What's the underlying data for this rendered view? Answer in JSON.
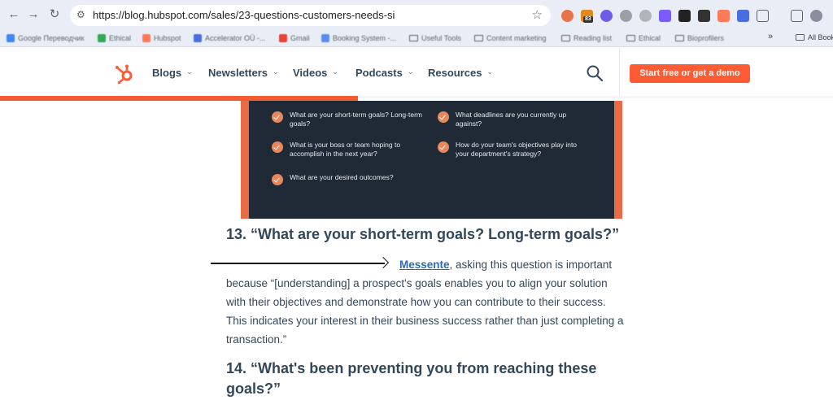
{
  "browser": {
    "url": "https://blog.hubspot.com/sales/23-questions-customers-needs-si",
    "extension_badge": "83",
    "bookmarks": [
      {
        "label": "Google Переводчик",
        "type": "site",
        "color": "#4285f4"
      },
      {
        "label": "Ethical",
        "type": "site",
        "color": "#34a853"
      },
      {
        "label": "Hubspot",
        "type": "site",
        "color": "#ff7a59"
      },
      {
        "label": "Accelerator OÜ -...",
        "type": "site",
        "color": "#4a6ee0"
      },
      {
        "label": "Gmail",
        "type": "site",
        "color": "#ea4335"
      },
      {
        "label": "Booking System -...",
        "type": "site",
        "color": "#5b8def"
      },
      {
        "label": "Useful Tools",
        "type": "folder"
      },
      {
        "label": "Content marketing",
        "type": "folder"
      },
      {
        "label": "Reading list",
        "type": "folder"
      },
      {
        "label": "Ethical",
        "type": "folder"
      },
      {
        "label": "Bioprofilers",
        "type": "folder"
      }
    ],
    "bookmarks_overflow": "»",
    "all_bookmarks": "All Book"
  },
  "site_nav": {
    "menu": [
      {
        "label": "Blogs"
      },
      {
        "label": "Newsletters"
      },
      {
        "label": "Videos"
      },
      {
        "label": "Podcasts"
      },
      {
        "label": "Resources"
      }
    ],
    "cta_label": "Start free or get a demo",
    "brand_color": "#ff5c35"
  },
  "embed": {
    "goals": [
      "What are your short-term goals? Long-term goals?",
      "What deadlines are you currently up against?",
      "What is your boss or team hoping to accomplish in the next year?",
      "How do your team's objectives play into your department's strategy?",
      "What are your desired outcomes?"
    ]
  },
  "article": {
    "heading_13": "13. “What are your short-term goals? Long-term goals?”",
    "para_link": "Messente",
    "para_line1_rest": ", asking this question is important",
    "para_line2": "because “[understanding] a prospect's goals enables you to align your solution",
    "para_line3": "with their objectives and demonstrate how you can contribute to their success.",
    "para_line4": "This indicates your interest in their business success rather than just completing a",
    "para_line5": "transaction.”",
    "heading_14_line1": "14. “What's been preventing you from reaching these",
    "heading_14_line2": "goals?”"
  }
}
